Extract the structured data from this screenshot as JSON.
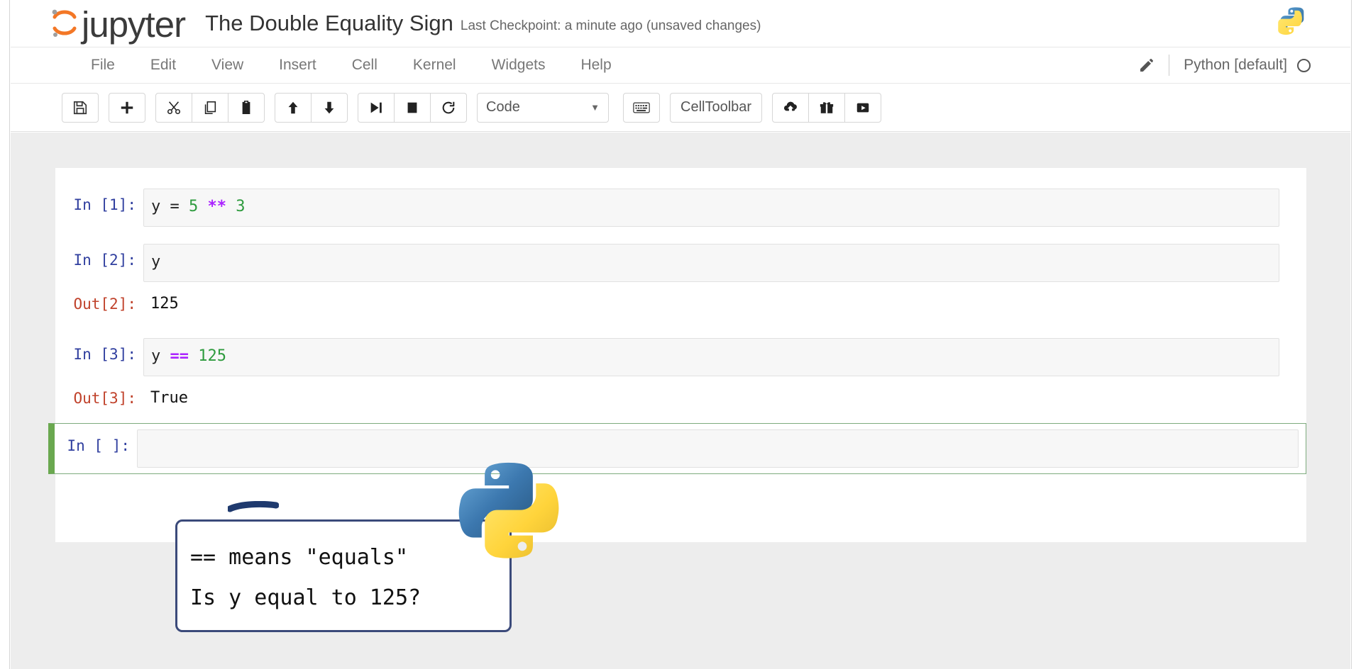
{
  "app": {
    "brand": "jupyter",
    "brand_icon": "jupyter-planet-icon",
    "notebook_title": "The Double Equality Sign",
    "checkpoint": "Last Checkpoint: a minute ago (unsaved changes)",
    "header_logo_icon": "python-logo-icon"
  },
  "menubar": {
    "items": [
      {
        "label": "File"
      },
      {
        "label": "Edit"
      },
      {
        "label": "View"
      },
      {
        "label": "Insert"
      },
      {
        "label": "Cell"
      },
      {
        "label": "Kernel"
      },
      {
        "label": "Widgets"
      },
      {
        "label": "Help"
      }
    ],
    "edit_mode_icon": "pencil-icon",
    "kernel_name": "Python [default]",
    "kernel_status_icon": "kernel-idle-circle-icon"
  },
  "toolbar": {
    "buttons": [
      {
        "name": "save-button",
        "icon": "floppy-disk-icon",
        "glyph": "save"
      },
      {
        "name": "insert-cell-button",
        "icon": "plus-icon",
        "glyph": "plus"
      },
      {
        "name": "cut-cell-button",
        "icon": "scissors-icon",
        "glyph": "cut"
      },
      {
        "name": "copy-cell-button",
        "icon": "copy-icon",
        "glyph": "copy"
      },
      {
        "name": "paste-cell-button",
        "icon": "paste-icon",
        "glyph": "paste"
      },
      {
        "name": "move-cell-up-button",
        "icon": "arrow-up-icon",
        "glyph": "up"
      },
      {
        "name": "move-cell-down-button",
        "icon": "arrow-down-icon",
        "glyph": "down"
      },
      {
        "name": "run-cell-button",
        "icon": "run-icon",
        "glyph": "run"
      },
      {
        "name": "interrupt-kernel-button",
        "icon": "stop-square-icon",
        "glyph": "stop"
      },
      {
        "name": "restart-kernel-button",
        "icon": "restart-circle-arrow-icon",
        "glyph": "restart"
      }
    ],
    "cell_type_value": "Code",
    "cell_type_caret": "▼",
    "keyboard_shortcut_icon": "keyboard-icon",
    "celltoolbar_label": "CellToolbar",
    "publish_icon": "cloud-upload-icon",
    "gift_icon": "gift-icon",
    "present_icon": "play-rect-icon"
  },
  "notebook": {
    "cells": [
      {
        "prompt": "In [1]:",
        "prompt_type": "in",
        "code_tokens": [
          {
            "text": "y = ",
            "type": "plain"
          },
          {
            "text": "5",
            "type": "number"
          },
          {
            "text": " ",
            "type": "plain"
          },
          {
            "text": "**",
            "type": "operator"
          },
          {
            "text": " ",
            "type": "plain"
          },
          {
            "text": "3",
            "type": "number"
          }
        ]
      },
      {
        "prompt": "In [2]:",
        "prompt_type": "in",
        "code_tokens": [
          {
            "text": "y",
            "type": "plain"
          }
        ],
        "output_prompt": "Out[2]:",
        "output_text": "125"
      },
      {
        "prompt": "In [3]:",
        "prompt_type": "in",
        "code_tokens": [
          {
            "text": "y ",
            "type": "plain"
          },
          {
            "text": "==",
            "type": "operator"
          },
          {
            "text": " ",
            "type": "plain"
          },
          {
            "text": "125",
            "type": "number"
          }
        ],
        "output_prompt": "Out[3]:",
        "output_text": "True"
      },
      {
        "prompt": "In [ ]:",
        "prompt_type": "in",
        "selected": true,
        "code_tokens": []
      }
    ]
  },
  "annotations": {
    "underline": {
      "name": "hand-drawn-underline",
      "color": "#1f3a6e",
      "target": "True"
    },
    "callout": {
      "lines": [
        "== means \"equals\"",
        "Is y equal to 125?"
      ],
      "border_color": "#3b4a7a"
    },
    "python_logo_overlay": {
      "icon": "python-logo-icon",
      "blue": "#3572A5",
      "yellow": "#FFD43B"
    }
  },
  "colors": {
    "prompt_in": "#303F9F",
    "prompt_out": "#C0422B",
    "code_bg": "#f7f7f7",
    "selected_cell_border": "#6aa84f",
    "number_token": "#2E9B3E",
    "operator_token": "#AA22FF",
    "page_bg": "#ededed",
    "jupyter_orange": "#F37726"
  }
}
